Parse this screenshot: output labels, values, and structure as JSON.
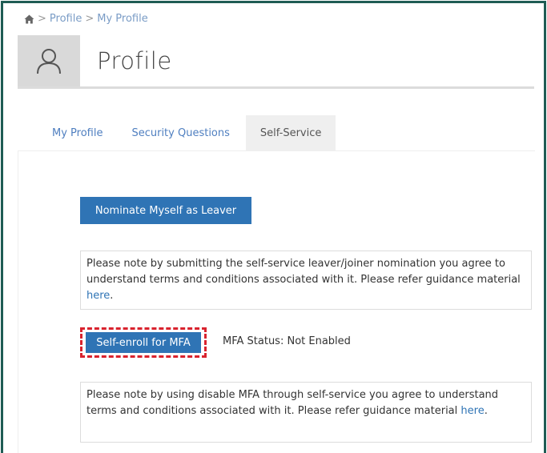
{
  "breadcrumb": {
    "icon": "home-icon",
    "items": [
      "Profile",
      "My Profile"
    ],
    "separator": ">"
  },
  "header": {
    "avatar_icon": "user-icon",
    "title": "Profile"
  },
  "tabs": [
    {
      "label": "My Profile",
      "active": false
    },
    {
      "label": "Security Questions",
      "active": false
    },
    {
      "label": "Self-Service",
      "active": true
    }
  ],
  "self_service": {
    "leaver_button_label": "Nominate Myself as Leaver",
    "leaver_note": {
      "text": "Please note by submitting the self-service leaver/joiner nomination you agree to understand terms and conditions associated with it. Please refer guidance material ",
      "link": "here",
      "suffix": "."
    },
    "mfa_button_label": "Self-enroll for MFA",
    "mfa_status": "MFA Status: Not Enabled",
    "mfa_note": {
      "text": "Please note by using disable MFA through self-service you agree to understand terms and conditions associated with it. Please refer guidance material ",
      "link": "here",
      "suffix": "."
    }
  },
  "colors": {
    "frame_border": "#1f5c54",
    "primary_button": "#2f74b5",
    "highlight": "#d9232e",
    "link": "#2f74b5"
  }
}
